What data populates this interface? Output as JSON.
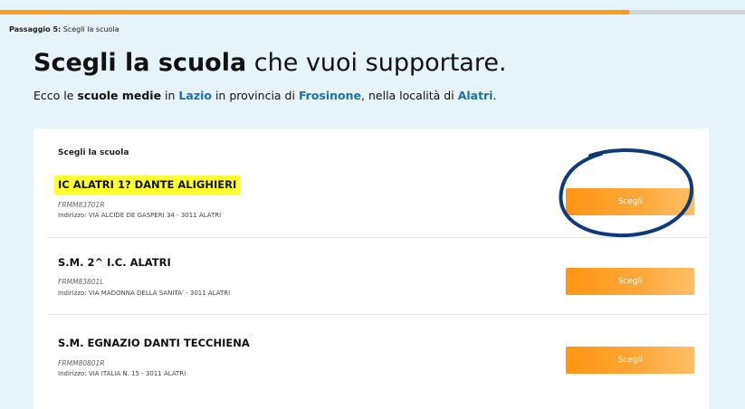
{
  "progress": {
    "value": 0.845,
    "fill_color": "#ff9a1f",
    "track_color": "#d3d7da"
  },
  "step": {
    "label": "Passaggio 5:",
    "text": "Scegli la scuola"
  },
  "title": {
    "bold": "Scegli la scuola",
    "rest": "che vuoi supportare."
  },
  "subtitle": {
    "t1": "Ecco le ",
    "type": "scuole medie",
    "t2": " in ",
    "region": "Lazio",
    "t3": " in provincia di ",
    "province": "Frosinone",
    "t4": ", nella località di ",
    "town": "Alatri",
    "t5": "."
  },
  "card": {
    "heading": "Scegli la scuola"
  },
  "schools": [
    {
      "name": "IC ALATRI 1? DANTE ALIGHIERI",
      "code": "FRMM83701R",
      "address": "Indirizzo: VIA ALCIDE DE GASPERI 34 - 3011 ALATRI",
      "button": "Scegli"
    },
    {
      "name": "S.M. 2^ I.C. ALATRI",
      "code": "FRMM83801L",
      "address": "Indirizzo: VIA MADONNA DELLA SANITA' - 3011 ALATRI",
      "button": "Scegli"
    },
    {
      "name": "S.M. EGNAZIO DANTI TECCHIENA",
      "code": "FRMM80801R",
      "address": "Indirizzo: VIA ITALIA N. 15 - 3011 ALATRI",
      "button": "Scegli"
    }
  ],
  "colors": {
    "accent": "#ff9a1f",
    "link": "#1f6fa8",
    "highlight": "#ffff33",
    "annotation": "#0d3a78",
    "background": "#e6f3f8"
  }
}
